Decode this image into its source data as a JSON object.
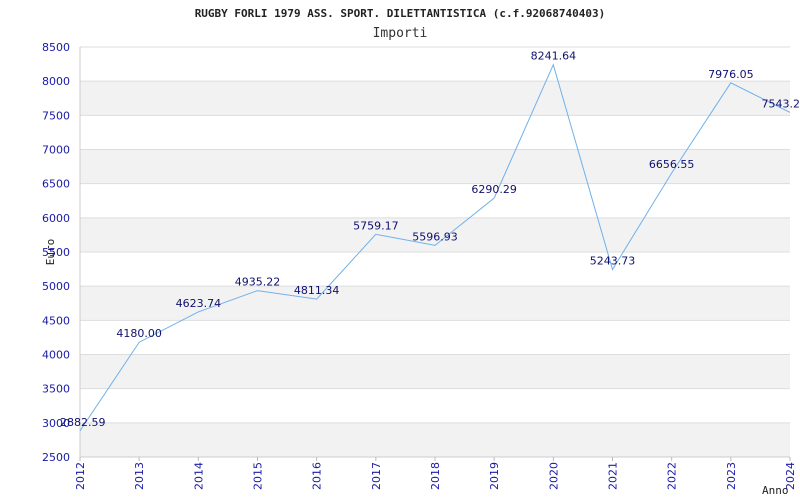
{
  "chart_data": {
    "type": "line",
    "title": "RUGBY FORLI 1979 ASS. SPORT. DILETTANTISTICA (c.f.92068740403)",
    "subtitle": "Importi",
    "xlabel": "Anno",
    "ylabel": "Euro",
    "x": [
      "2012",
      "2013",
      "2014",
      "2015",
      "2016",
      "2017",
      "2018",
      "2019",
      "2020",
      "2021",
      "2022",
      "2023",
      "2024"
    ],
    "values": [
      2882.59,
      4180.0,
      4623.74,
      4935.22,
      4811.34,
      5759.17,
      5596.93,
      6290.29,
      8241.64,
      5243.73,
      6656.55,
      7976.05,
      7543.2
    ],
    "value_labels": [
      "2882.59",
      "4180.00",
      "4623.74",
      "4935.22",
      "4811.34",
      "5759.17",
      "5596.93",
      "6290.29",
      "8241.64",
      "5243.73",
      "6656.55",
      "7976.05",
      "7543.2"
    ],
    "yticks": [
      "2500",
      "3000",
      "3500",
      "4000",
      "4500",
      "5000",
      "5500",
      "6000",
      "6500",
      "7000",
      "7500",
      "8000",
      "8500"
    ],
    "ylim": [
      2500,
      8500
    ],
    "grid": true,
    "colors": {
      "line": "#6fb1ea",
      "band": "#f2f2f2",
      "tick_text": "#1a1aa6",
      "label_text": "#10106e"
    }
  }
}
